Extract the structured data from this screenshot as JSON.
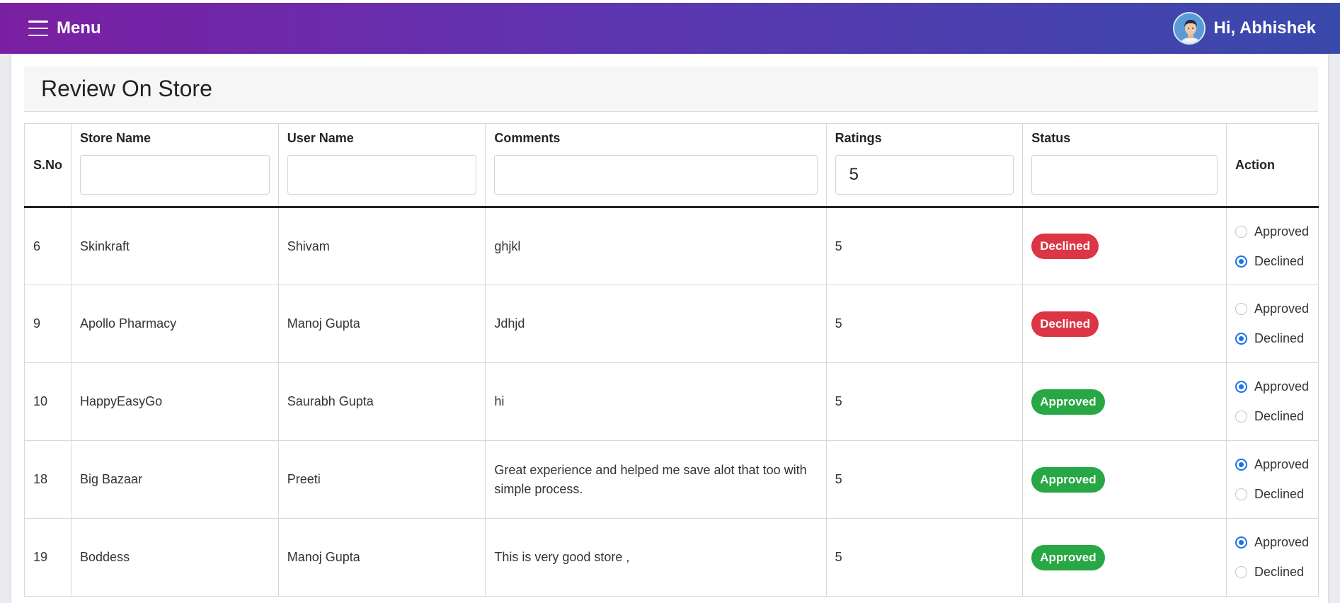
{
  "header": {
    "menu_label": "Menu",
    "greeting": "Hi, Abhishek"
  },
  "page": {
    "title": "Review On Store"
  },
  "table": {
    "columns": [
      "S.No",
      "Store Name",
      "User Name",
      "Comments",
      "Ratings",
      "Status",
      "Action"
    ],
    "filters": {
      "store_name": "",
      "user_name": "",
      "comments": "",
      "ratings": "5",
      "status": ""
    },
    "rows": [
      {
        "sno": "6",
        "store": "Skinkraft",
        "user": "Shivam",
        "comment": "ghjkl",
        "rating": "5",
        "status": "Declined"
      },
      {
        "sno": "9",
        "store": "Apollo Pharmacy",
        "user": "Manoj Gupta",
        "comment": "Jdhjd",
        "rating": "5",
        "status": "Declined"
      },
      {
        "sno": "10",
        "store": "HappyEasyGo",
        "user": "Saurabh Gupta",
        "comment": "hi",
        "rating": "5",
        "status": "Approved"
      },
      {
        "sno": "18",
        "store": "Big Bazaar",
        "user": "Preeti",
        "comment": "Great experience and helped me save alot that too with simple process.",
        "rating": "5",
        "status": "Approved"
      },
      {
        "sno": "19",
        "store": "Boddess",
        "user": "Manoj Gupta",
        "comment": "This is very good store ,",
        "rating": "5",
        "status": "Approved"
      }
    ],
    "action_options": [
      "Approved",
      "Declined"
    ]
  },
  "colors": {
    "header_gradient_start": "#7b1fa2",
    "header_gradient_end": "#3949ab",
    "declined": "#dc3545",
    "approved": "#28a745",
    "radio_selected": "#1a73e8"
  }
}
